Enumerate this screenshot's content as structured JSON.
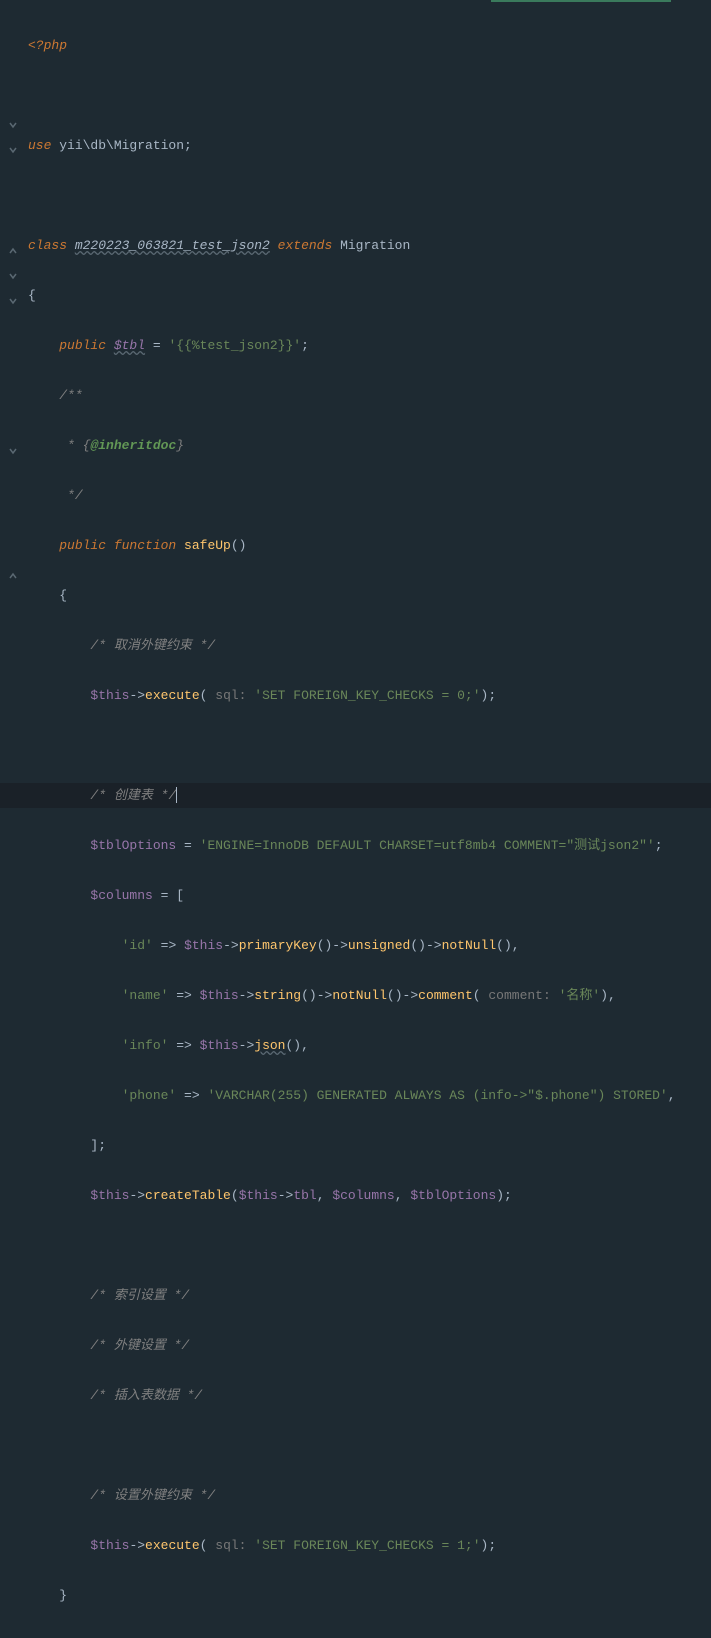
{
  "code": {
    "php_open": "<?php",
    "use_stmt": {
      "kw": "use ",
      "path": "yii\\db\\Migration;"
    },
    "class_decl": {
      "kw1": "class ",
      "name": "m220223_063821_test_json2",
      "kw2": " extends ",
      "parent": "Migration"
    },
    "brace_open": "{",
    "tbl_prop": {
      "vis": "public ",
      "var": "$tbl",
      "op": " = ",
      "str": "'{{%test_json2}}'",
      "semi": ";"
    },
    "doc_open": "/**",
    "doc_inherit": " * {",
    "doc_tag": "@inheritdoc",
    "doc_close_brace": "}",
    "doc_close": " */",
    "safeup": {
      "vis": "public ",
      "fn": "function ",
      "name": "safeUp",
      "parens": "()"
    },
    "brace_open2": "{",
    "c_cancel_fk": "/* 取消外键约束 */",
    "exec1": {
      "this": "$this",
      "arrow": "->",
      "fn": "execute",
      "hint": " sql: ",
      "str": "'SET FOREIGN_KEY_CHECKS = 0;'"
    },
    "c_create": "/* 创建表 *",
    "tblopt": {
      "var": "$tblOptions",
      "op": " = ",
      "str": "'ENGINE=InnoDB DEFAULT CHARSET=utf8mb4 COMMENT=\"测试json2\"'",
      "semi": ";"
    },
    "cols": {
      "var": "$columns",
      "op": " = ["
    },
    "col_id": {
      "key": "'id'",
      "arrow": " => ",
      "this": "$this",
      "ops": "->",
      "f1": "primaryKey",
      "f2": "unsigned",
      "f3": "notNull"
    },
    "col_name": {
      "key": "'name'",
      "arrow": " => ",
      "this": "$this",
      "f1": "string",
      "f2": "notNull",
      "f3": "comment",
      "hint": " comment: ",
      "str": "'名称'"
    },
    "col_info": {
      "key": "'info'",
      "arrow": " => ",
      "this": "$this",
      "f1": "json"
    },
    "col_phone": {
      "key": "'phone'",
      "arrow": " => ",
      "str": "'VARCHAR(255) GENERATED ALWAYS AS (info->\"$.phone\") STORED'"
    },
    "bracket_close": "];",
    "create_tbl": {
      "this": "$this",
      "f1": "createTable",
      "arg1": "$this",
      "prop": "tbl",
      "arg2": "$columns",
      "arg3": "$tblOptions"
    },
    "c_index": "/* 索引设置 */",
    "c_fk": "/* 外键设置 */",
    "c_insert": "/* 插入表数据 */",
    "c_set_fk": "/* 设置外键约束 */",
    "exec2": {
      "this": "$this",
      "fn": "execute",
      "hint": " sql: ",
      "str": "'SET FOREIGN_KEY_CHECKS = 1;'"
    },
    "brace_close": "}"
  }
}
